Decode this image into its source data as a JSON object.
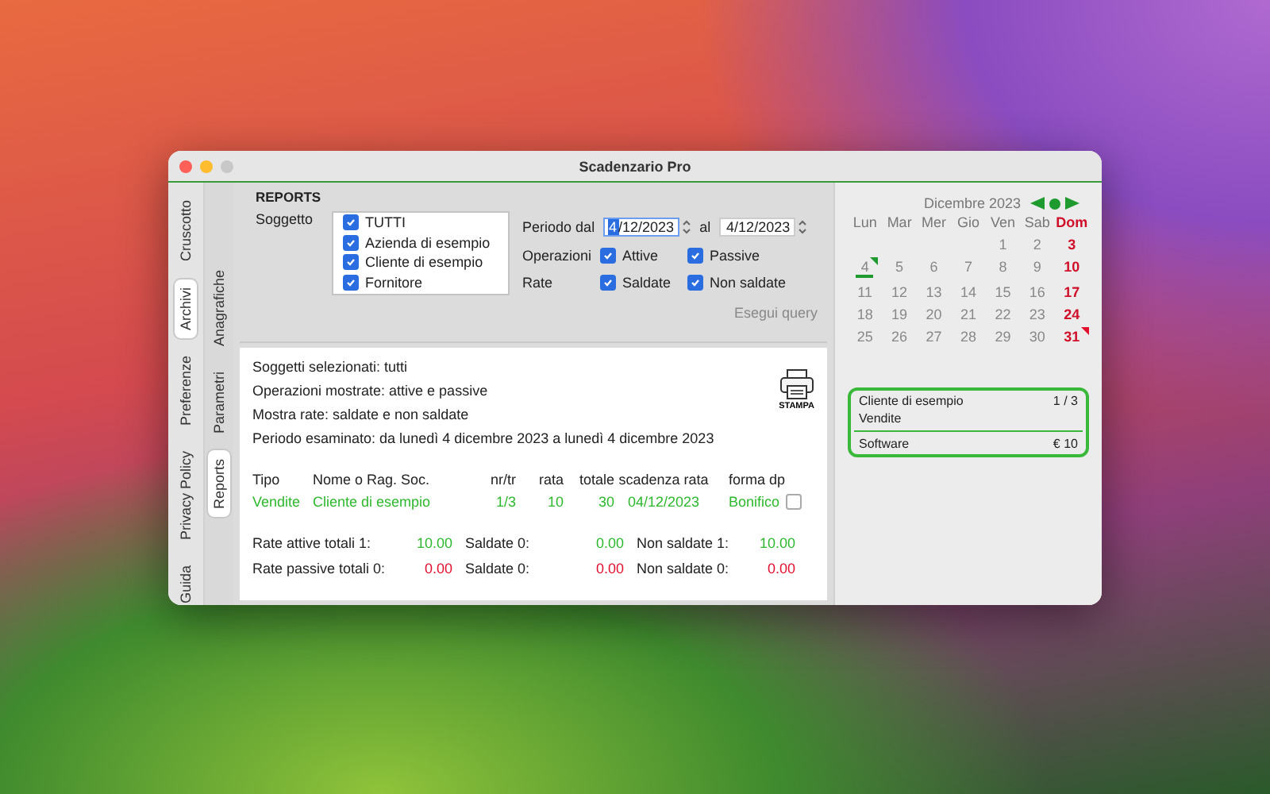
{
  "window": {
    "title": "Scadenzario Pro"
  },
  "outer_tabs": [
    {
      "label": "Cruscotto",
      "selected": false
    },
    {
      "label": "Archivi",
      "selected": true
    },
    {
      "label": "Preferenze",
      "selected": false
    },
    {
      "label": "Privacy Policy",
      "selected": false
    },
    {
      "label": "Guida",
      "selected": false
    }
  ],
  "inner_tabs": [
    {
      "label": "Anagrafiche",
      "selected": false
    },
    {
      "label": "Parametri",
      "selected": false
    },
    {
      "label": "Reports",
      "selected": true
    }
  ],
  "reports": {
    "title": "REPORTS",
    "subject_label": "Soggetto",
    "subjects": [
      {
        "label": "TUTTI",
        "checked": true
      },
      {
        "label": "Azienda di esempio",
        "checked": true
      },
      {
        "label": "Cliente di esempio",
        "checked": true
      },
      {
        "label": "Fornitore",
        "checked": true
      }
    ],
    "period_label": "Periodo dal",
    "date_from": {
      "value": "4/12/2023",
      "focused": true
    },
    "to_label": "al",
    "date_to": {
      "value": "4/12/2023",
      "focused": false
    },
    "operations_label": "Operazioni",
    "operations": [
      {
        "label": "Attive",
        "checked": true
      },
      {
        "label": "Passive",
        "checked": true
      }
    ],
    "rate_label": "Rate",
    "rates": [
      {
        "label": "Saldate",
        "checked": true
      },
      {
        "label": "Non saldate",
        "checked": true
      }
    ],
    "query_button": "Esegui query"
  },
  "report": {
    "summary": [
      "Soggetti selezionati: tutti",
      "Operazioni mostrate: attive e passive",
      "Mostra rate: saldate e non saldate",
      "Periodo esaminato: da lunedì 4 dicembre 2023 a lunedì 4 dicembre 2023"
    ],
    "print_button": "STAMPA",
    "columns": [
      "Tipo",
      "Nome o Rag. Soc.",
      "nr/tr",
      "rata",
      "totale",
      "scadenza rata",
      "forma dp"
    ],
    "rows": [
      {
        "cells": [
          "Vendite",
          "Cliente di esempio",
          "1/3",
          "10",
          "30",
          "04/12/2023",
          "Bonifico"
        ],
        "checked": false
      }
    ],
    "totals": [
      {
        "cells": [
          "Rate attive totali 1:",
          "10.00",
          "Saldate 0:",
          "0.00",
          "Non saldate 1:",
          "10.00"
        ],
        "color": "#2eb82e"
      },
      {
        "cells": [
          "Rate passive totali 0:",
          "0.00",
          "Saldate 0:",
          "0.00",
          "Non saldate 0:",
          "0.00"
        ],
        "color": "#e0102e"
      }
    ]
  },
  "calendar": {
    "month": "Dicembre 2023",
    "weekdays": [
      {
        "label": "Lun",
        "holiday": false
      },
      {
        "label": "Mar",
        "holiday": false
      },
      {
        "label": "Mer",
        "holiday": false
      },
      {
        "label": "Gio",
        "holiday": false
      },
      {
        "label": "Ven",
        "holiday": false
      },
      {
        "label": "Sab",
        "holiday": false
      },
      {
        "label": "Dom",
        "holiday": true
      }
    ],
    "weeks": [
      [
        {
          "label": "1",
          "holiday": false,
          "today": false
        },
        {
          "label": "2",
          "holiday": false,
          "today": false
        },
        {
          "label": "3",
          "holiday": true,
          "today": false
        }
      ],
      [
        {
          "label": "4",
          "holiday": false,
          "today": true,
          "color": "#1f9a2f"
        },
        {
          "label": "5",
          "holiday": false,
          "today": false
        },
        {
          "label": "6",
          "holiday": false,
          "today": false
        },
        {
          "label": "7",
          "holiday": false,
          "today": false
        },
        {
          "label": "8",
          "holiday": false,
          "today": false
        },
        {
          "label": "9",
          "holiday": false,
          "today": false
        },
        {
          "label": "10",
          "holiday": true,
          "today": false
        }
      ],
      [
        {
          "label": "11",
          "holiday": false,
          "today": false
        },
        {
          "label": "12",
          "holiday": false,
          "today": false
        },
        {
          "label": "13",
          "holiday": false,
          "today": false
        },
        {
          "label": "14",
          "holiday": false,
          "today": false
        },
        {
          "label": "15",
          "holiday": false,
          "today": false
        },
        {
          "label": "16",
          "holiday": false,
          "today": false
        },
        {
          "label": "17",
          "holiday": true,
          "today": false
        }
      ],
      [
        {
          "label": "18",
          "holiday": false,
          "today": false
        },
        {
          "label": "19",
          "holiday": false,
          "today": false
        },
        {
          "label": "20",
          "holiday": false,
          "today": false
        },
        {
          "label": "21",
          "holiday": false,
          "today": false
        },
        {
          "label": "22",
          "holiday": false,
          "today": false
        },
        {
          "label": "23",
          "holiday": false,
          "today": false
        },
        {
          "label": "24",
          "holiday": true,
          "today": false
        }
      ],
      [
        {
          "label": "25",
          "holiday": false,
          "today": false
        },
        {
          "label": "26",
          "holiday": false,
          "today": false
        },
        {
          "label": "27",
          "holiday": false,
          "today": false
        },
        {
          "label": "28",
          "holiday": false,
          "today": false
        },
        {
          "label": "29",
          "holiday": false,
          "today": false
        },
        {
          "label": "30",
          "holiday": false,
          "today": false
        },
        {
          "label": "31",
          "holiday": true,
          "today": false,
          "color": "#e0102e"
        }
      ]
    ]
  },
  "card": {
    "client": "Cliente di esempio",
    "installment": "1 / 3",
    "type": "Vendite",
    "item": "Software",
    "amount": "€ 10"
  }
}
